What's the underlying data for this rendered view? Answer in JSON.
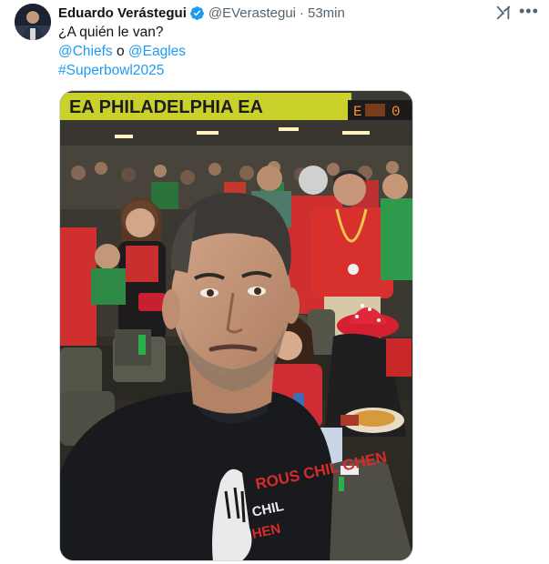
{
  "author": {
    "name": "Eduardo Verástegui",
    "handle": "@EVerastegui",
    "separator": "·",
    "time": "53min",
    "verified": true,
    "avatar_icon": "profile-photo"
  },
  "actions": {
    "grok_icon": "grok-icon",
    "more_label": "•••"
  },
  "tweet": {
    "line1": "¿A quién le van?",
    "mention1": "@Chiefs",
    "connector": " o ",
    "mention2": "@Eagles",
    "hashtag": "#Superbowl2025"
  },
  "media": {
    "banner_text": "EA  PHILADELPHIA EA",
    "scoreboard_left": "E",
    "scoreboard_right": "0",
    "shirt_text": "ROUS  CHIL GHEN",
    "colors": {
      "link": "#1d9bf0",
      "verified": "#1d9bf0",
      "banner": "#c9d12a",
      "shirt_red": "#d92b2b"
    }
  }
}
